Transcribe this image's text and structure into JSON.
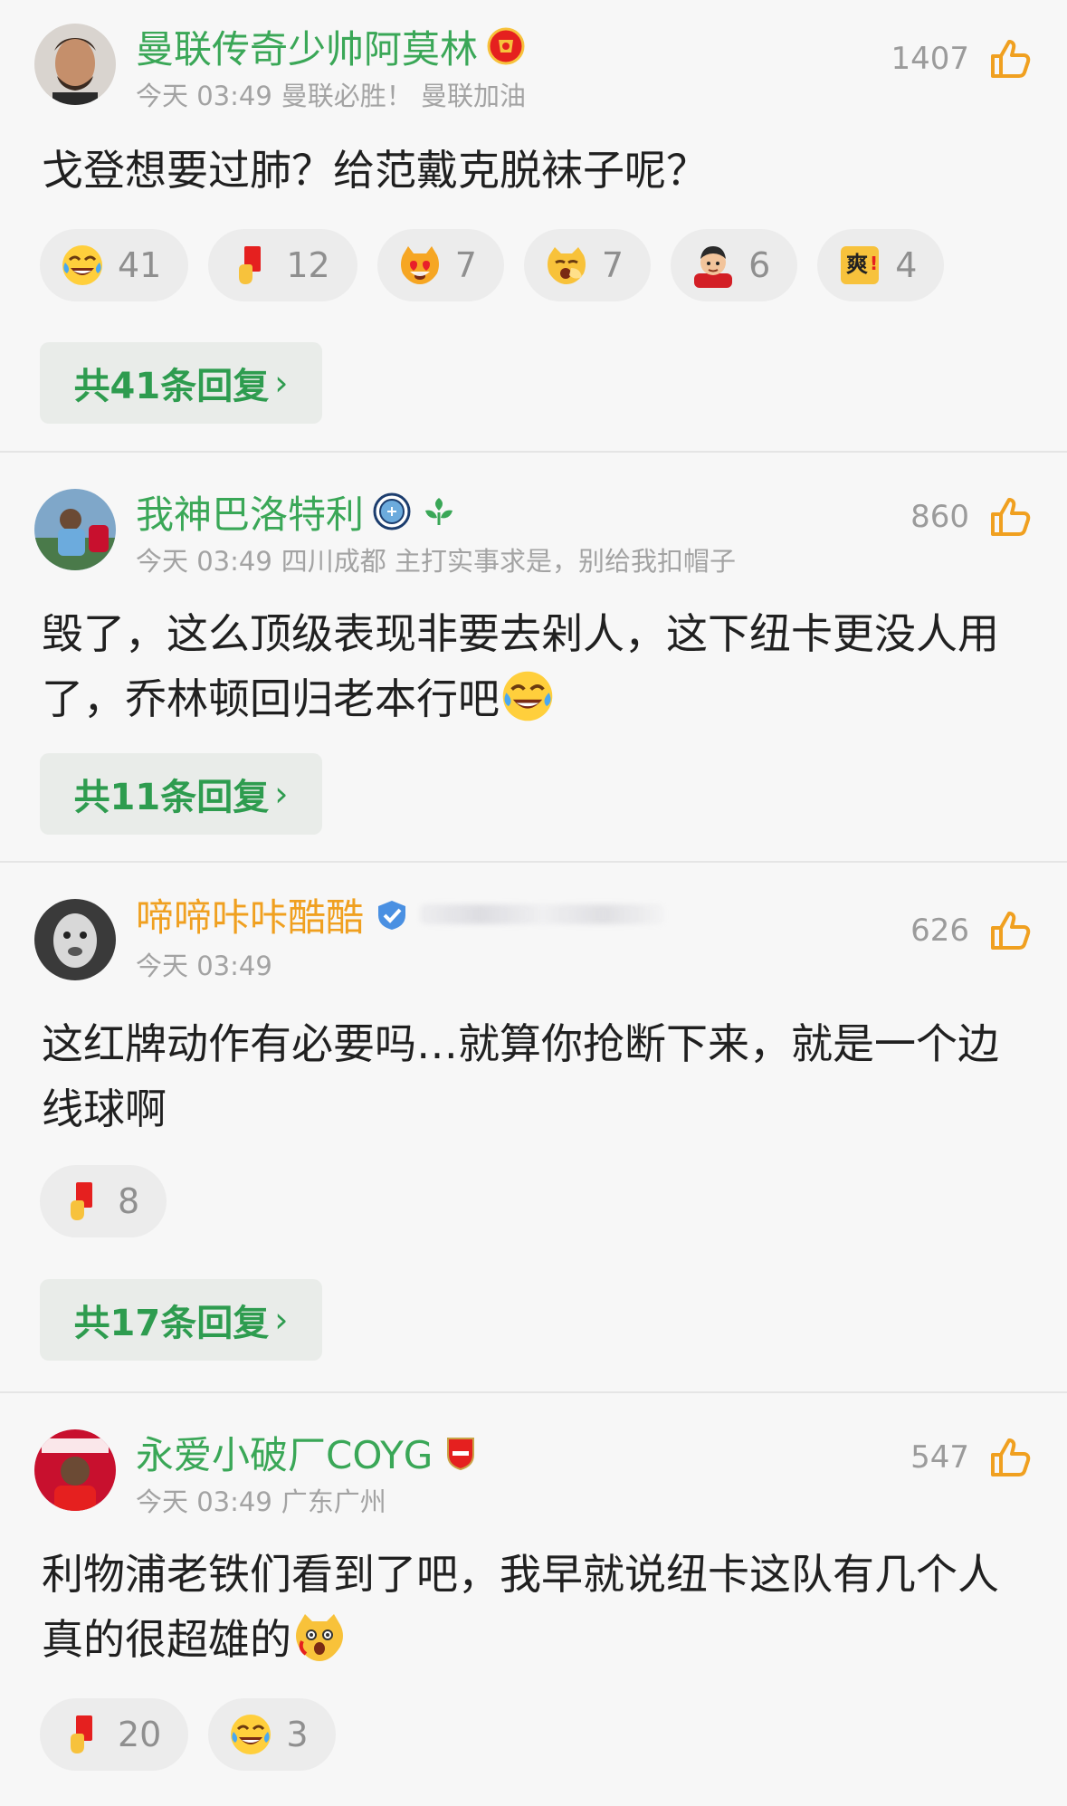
{
  "comments": [
    {
      "username": "曼联传奇少帅阿莫林",
      "time": "今天 03:49",
      "extra": "曼联必胜！ 曼联加油",
      "likes": "1407",
      "text": "戈登想要过肺？给范戴克脱袜子呢？",
      "reactions": [
        {
          "icon": "laugh-cry-emoji-icon",
          "count": "41"
        },
        {
          "icon": "red-card-icon",
          "count": "12"
        },
        {
          "icon": "heart-eyes-cat-icon",
          "count": "7"
        },
        {
          "icon": "yawn-face-icon",
          "count": "7"
        },
        {
          "icon": "player-avatar-icon",
          "count": "6"
        },
        {
          "icon": "shuang-sticker-icon",
          "count": "4"
        }
      ],
      "reply_label": "共41条回复"
    },
    {
      "username": "我神巴洛特利",
      "time": "今天 03:49",
      "extra": "四川成都 主打实事求是，别给我扣帽子",
      "likes": "860",
      "text": "毁了，这么顶级表现非要去剁人，这下纽卡更没人用了，乔林顿回归老本行吧",
      "reply_label": "共11条回复"
    },
    {
      "username": "啼啼咔咔酷酷",
      "time": "今天 03:49",
      "extra": "",
      "likes": "626",
      "text": "这红牌动作有必要吗…就算你抢断下来，就是一个边线球啊",
      "reactions": [
        {
          "icon": "red-card-icon",
          "count": "8"
        }
      ],
      "reply_label": "共17条回复"
    },
    {
      "username": "永爱小破厂COYG",
      "time": "今天 03:49",
      "extra": "广东广州",
      "likes": "547",
      "text": "利物浦老铁们看到了吧，我早就说纽卡这队有几个人真的很超雄的",
      "reactions": [
        {
          "icon": "red-card-icon",
          "count": "20"
        },
        {
          "icon": "laugh-cry-emoji-icon",
          "count": "3"
        }
      ]
    }
  ],
  "chevron": "›",
  "colors": {
    "username_green": "#3aa757",
    "username_gold": "#f0a020",
    "reply_green": "#2e9c4f",
    "like_orange": "#f5a623"
  }
}
